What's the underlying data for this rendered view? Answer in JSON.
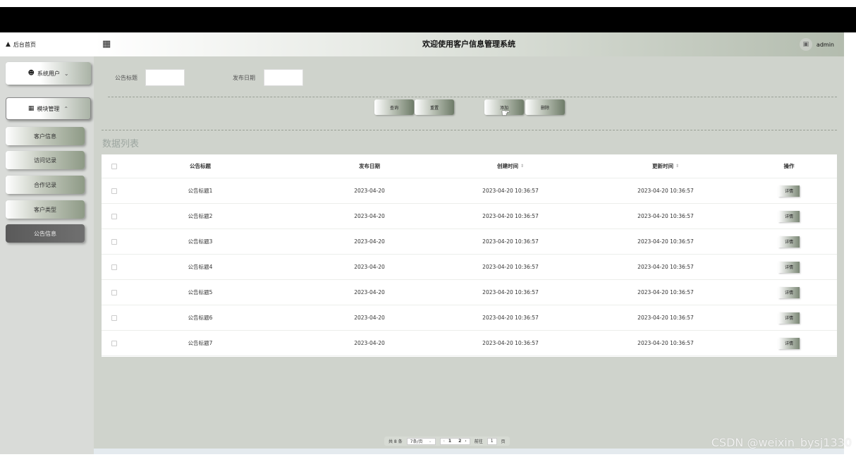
{
  "sidebar": {
    "home": "后台首页",
    "groups": [
      {
        "label": "系统用户"
      },
      {
        "label": "模块管理"
      }
    ],
    "items": [
      "客户信息",
      "访问记录",
      "合作记录",
      "客户类型",
      "公告信息"
    ]
  },
  "header": {
    "title": "欢迎使用客户信息管理系统",
    "user": "admin"
  },
  "filters": {
    "title_label": "公告标题",
    "date_label": "发布日期",
    "title_value": "",
    "date_value": ""
  },
  "actions": {
    "query": "查询",
    "reset": "重置",
    "add": "添加",
    "delete": "删除"
  },
  "list": {
    "title": "数据列表",
    "columns": [
      "公告标题",
      "发布日期",
      "创建时间",
      "更新时间",
      "操作"
    ],
    "rows": [
      {
        "title": "公告标题1",
        "date": "2023-04-20",
        "created": "2023-04-20 10:36:57",
        "updated": "2023-04-20 10:36:57",
        "action": "详情"
      },
      {
        "title": "公告标题2",
        "date": "2023-04-20",
        "created": "2023-04-20 10:36:57",
        "updated": "2023-04-20 10:36:57",
        "action": "详情"
      },
      {
        "title": "公告标题3",
        "date": "2023-04-20",
        "created": "2023-04-20 10:36:57",
        "updated": "2023-04-20 10:36:57",
        "action": "详情"
      },
      {
        "title": "公告标题4",
        "date": "2023-04-20",
        "created": "2023-04-20 10:36:57",
        "updated": "2023-04-20 10:36:57",
        "action": "详情"
      },
      {
        "title": "公告标题5",
        "date": "2023-04-20",
        "created": "2023-04-20 10:36:57",
        "updated": "2023-04-20 10:36:57",
        "action": "详情"
      },
      {
        "title": "公告标题6",
        "date": "2023-04-20",
        "created": "2023-04-20 10:36:57",
        "updated": "2023-04-20 10:36:57",
        "action": "详情"
      },
      {
        "title": "公告标题7",
        "date": "2023-04-20",
        "created": "2023-04-20 10:36:57",
        "updated": "2023-04-20 10:36:57",
        "action": "详情"
      }
    ]
  },
  "pagination": {
    "total": "共 8 条",
    "page_size": "7条/页",
    "pages": [
      "1",
      "2"
    ],
    "goto_label": "前往",
    "goto_value": "1",
    "page_suffix": "页"
  },
  "watermark": "CSDN @weixin_bysj1330"
}
